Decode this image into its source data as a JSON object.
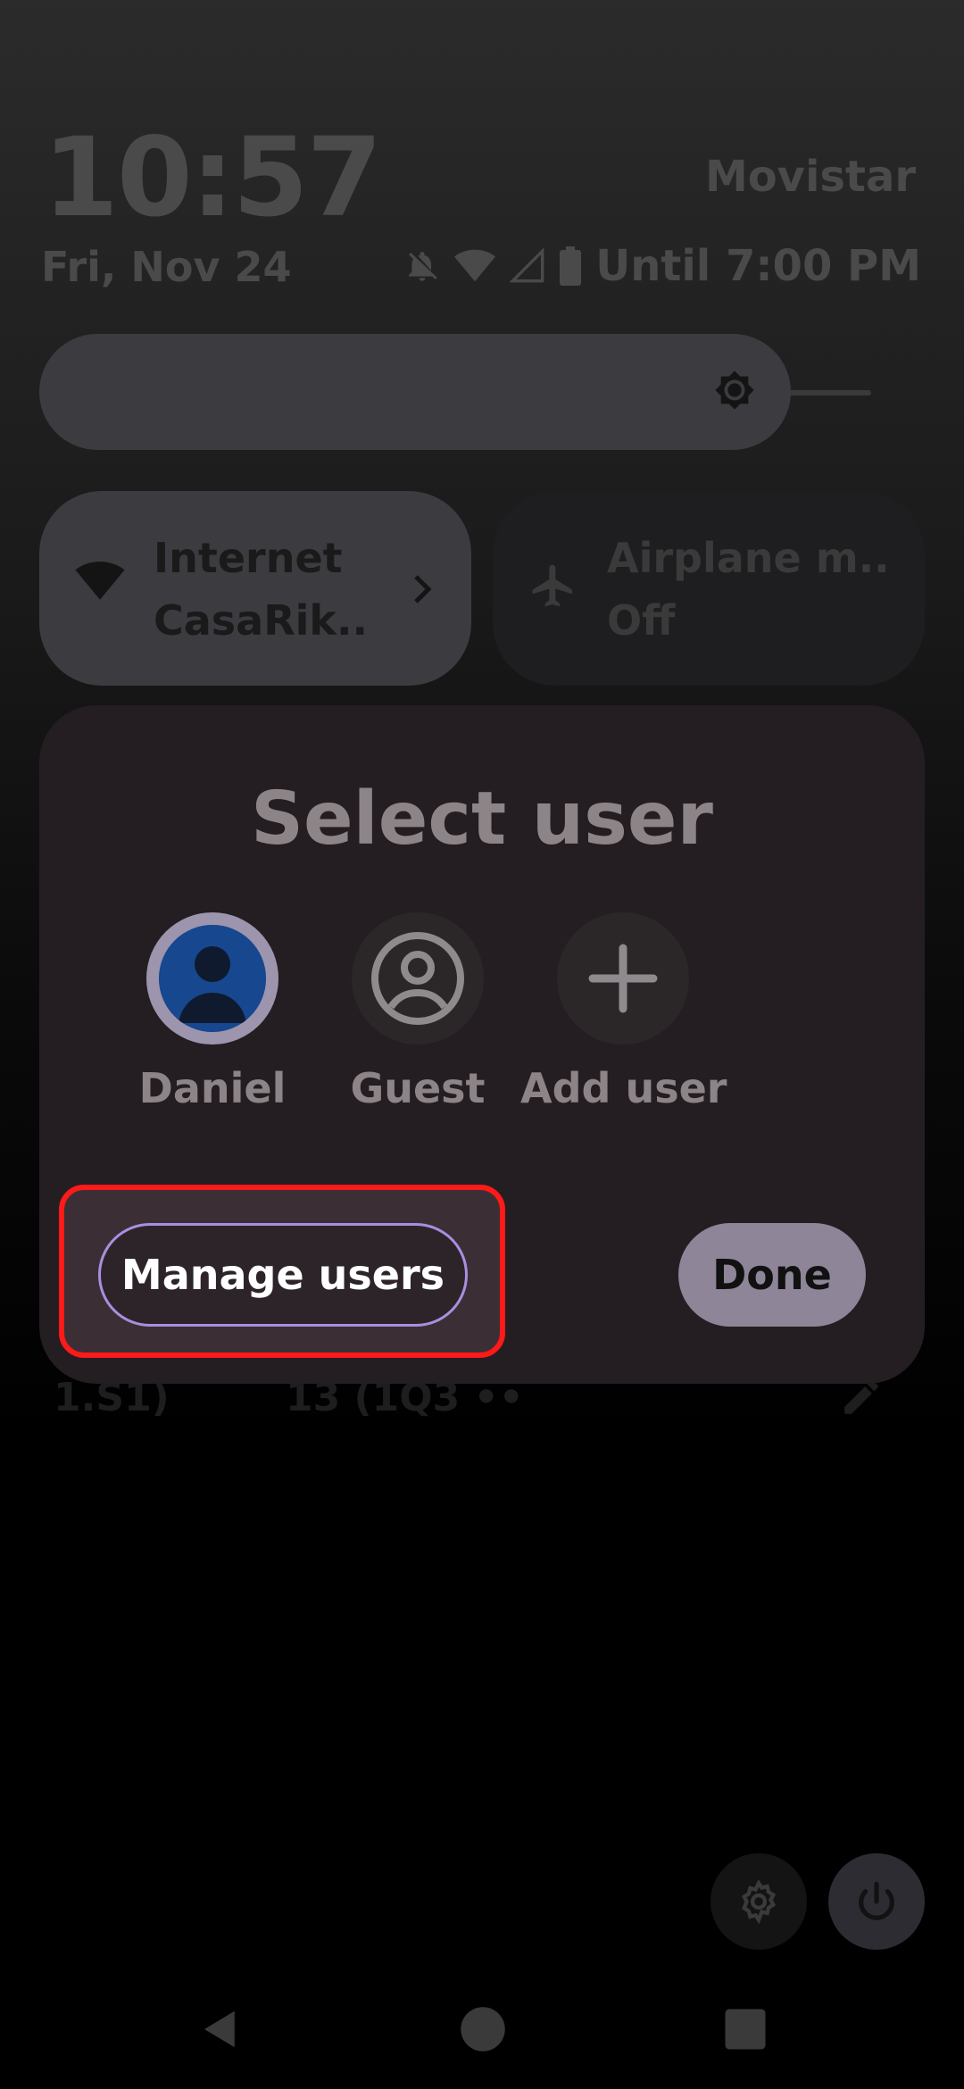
{
  "status_bar": {
    "time": "10:57",
    "carrier": "Movistar",
    "date": "Fri, Nov 24",
    "until": "Until 7:00 PM",
    "icons": [
      "bell-off-icon",
      "wifi-icon",
      "cell-signal-icon",
      "battery-icon"
    ]
  },
  "quick_settings": {
    "internet": {
      "title": "Internet",
      "subtitle": "CasaRik..",
      "icon": "wifi-icon"
    },
    "airplane": {
      "title": "Airplane m..",
      "subtitle": "Off",
      "icon": "airplane-icon"
    }
  },
  "behind_text": {
    "left": "1.S1)",
    "middle": "13 (1Q3 ••"
  },
  "dialog": {
    "title": "Select user",
    "users": [
      {
        "label": "Daniel",
        "icon": "person-icon"
      },
      {
        "label": "Guest",
        "icon": "guest-icon"
      },
      {
        "label": "Add user",
        "icon": "plus-icon"
      }
    ],
    "manage_label": "Manage users",
    "done_label": "Done"
  },
  "colors": {
    "accent_outline": "#a98fe0",
    "highlight_red": "#ff1a1a",
    "selected_user": "#17478f"
  }
}
